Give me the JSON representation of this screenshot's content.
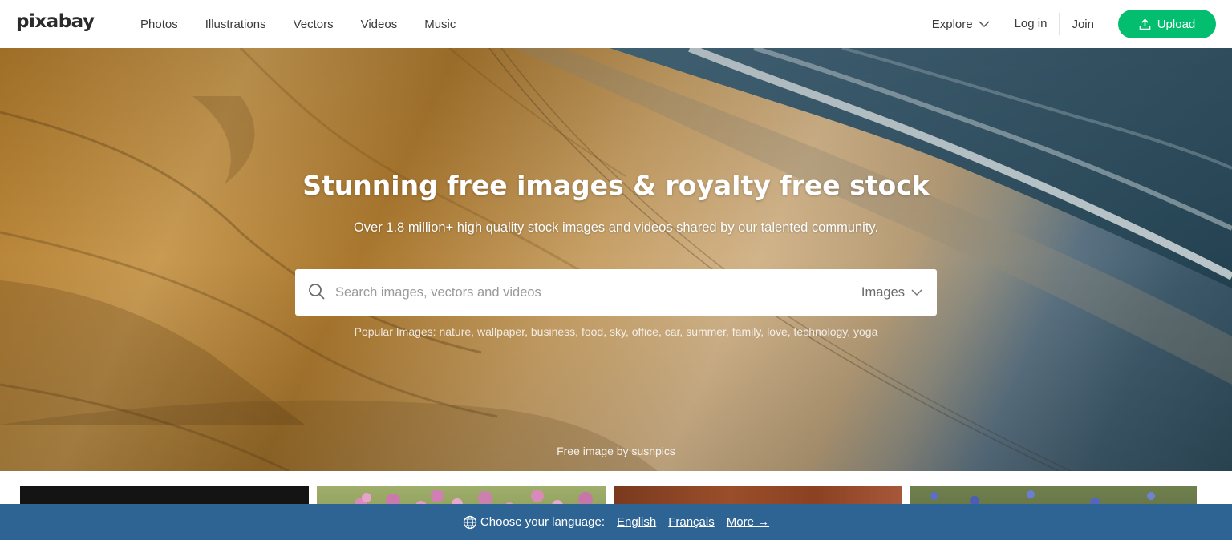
{
  "brand": {
    "logo_text": "pixabay",
    "accent_color": "#02be6e",
    "language_bar_color": "#2e6494"
  },
  "nav": {
    "links": [
      "Photos",
      "Illustrations",
      "Vectors",
      "Videos",
      "Music"
    ],
    "explore_label": "Explore",
    "login_label": "Log in",
    "join_label": "Join",
    "upload_label": "Upload"
  },
  "hero": {
    "title": "Stunning free images & royalty free stock",
    "subtitle": "Over 1.8 million+ high quality stock images and videos shared by our talented community.",
    "search": {
      "placeholder": "Search images, vectors and videos",
      "value": "",
      "type_label": "Images"
    },
    "popular_label": "Popular Images:",
    "popular_tags": [
      "nature",
      "wallpaper",
      "business",
      "food",
      "sky",
      "office",
      "car",
      "summer",
      "family",
      "love",
      "technology",
      "yoga"
    ],
    "credit": "Free image by susnpics"
  },
  "language_bar": {
    "label": "Choose your language:",
    "languages": [
      "English",
      "Français"
    ],
    "more_label": "More →"
  },
  "icons": {
    "explore": "chevron-down-icon",
    "upload": "upload-icon",
    "search": "search-icon",
    "search_type": "chevron-down-icon",
    "language": "globe-icon"
  }
}
